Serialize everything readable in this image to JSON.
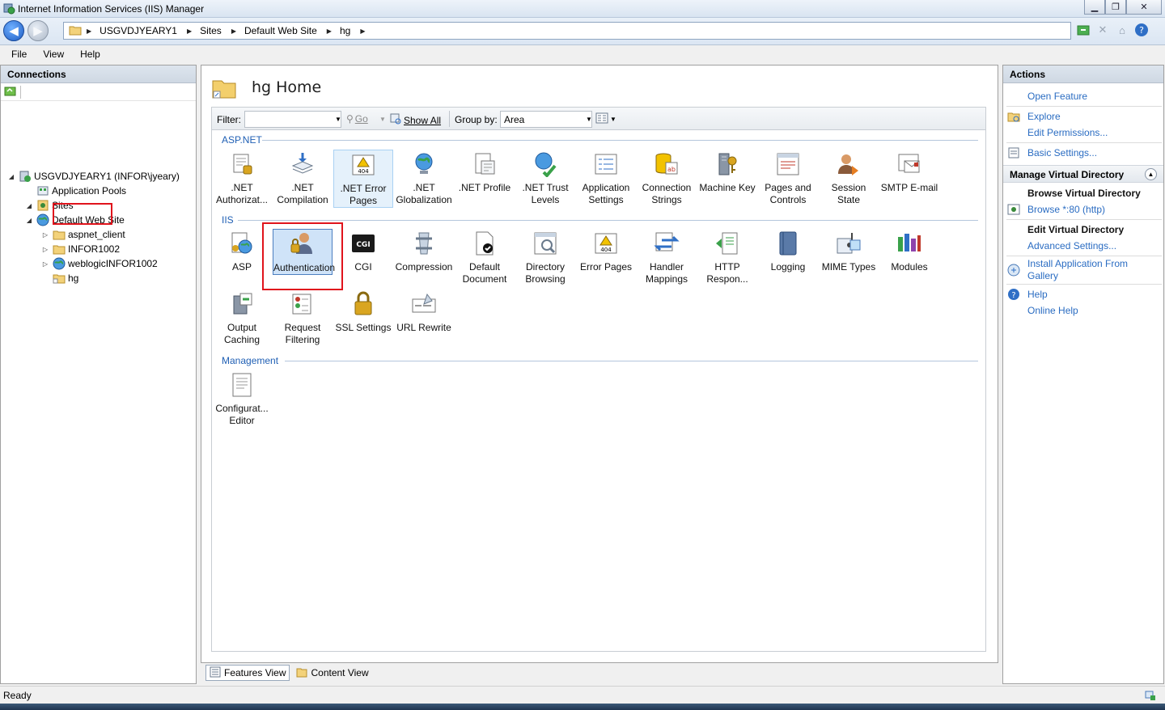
{
  "window": {
    "title": "Internet Information Services (IIS) Manager"
  },
  "address": {
    "crumbs": [
      "USGVDJYEARY1",
      "Sites",
      "Default Web Site",
      "hg"
    ]
  },
  "menu": {
    "file": "File",
    "view": "View",
    "help": "Help"
  },
  "connections": {
    "header": "Connections",
    "tree": [
      {
        "label": "USGVDJYEARY1 (INFOR\\jyeary)",
        "icon": "server-icon",
        "level": 0,
        "expander": "expanded"
      },
      {
        "label": "Application Pools",
        "icon": "app-pools-icon",
        "level": 1,
        "expander": "none"
      },
      {
        "label": "Sites",
        "icon": "sites-icon",
        "level": 1,
        "expander": "expanded"
      },
      {
        "label": "Default Web Site",
        "icon": "globe-icon",
        "level": 2,
        "expander": "expanded"
      },
      {
        "label": "aspnet_client",
        "icon": "folder-icon",
        "level": 3,
        "expander": "collapsed"
      },
      {
        "label": "INFOR1002",
        "icon": "folder-icon",
        "level": 3,
        "expander": "collapsed"
      },
      {
        "label": "weblogicINFOR1002",
        "icon": "globe-icon",
        "level": 3,
        "expander": "collapsed"
      },
      {
        "label": "hg",
        "icon": "virtual-folder-icon",
        "level": 3,
        "expander": "none",
        "selected": true
      }
    ]
  },
  "center": {
    "title": "hg Home",
    "filter": {
      "label": "Filter:",
      "value": "",
      "go": "Go",
      "show_all": "Show All",
      "group_by_label": "Group by:",
      "group_by_value": "Area"
    },
    "sections": {
      "aspnet": "ASP.NET",
      "iis": "IIS",
      "management": "Management"
    },
    "aspnet_features": [
      {
        "label": ".NET Authorizat...",
        "icon": "net-authorization-icon"
      },
      {
        "label": ".NET Compilation",
        "icon": "net-compilation-icon"
      },
      {
        "label": ".NET Error Pages",
        "icon": "net-error-pages-icon"
      },
      {
        "label": ".NET Globalization",
        "icon": "net-globalization-icon"
      },
      {
        "label": ".NET Profile",
        "icon": "net-profile-icon"
      },
      {
        "label": ".NET Trust Levels",
        "icon": "net-trust-levels-icon"
      },
      {
        "label": "Application Settings",
        "icon": "application-settings-icon"
      },
      {
        "label": "Connection Strings",
        "icon": "connection-strings-icon"
      },
      {
        "label": "Machine Key",
        "icon": "machine-key-icon"
      },
      {
        "label": "Pages and Controls",
        "icon": "pages-controls-icon"
      },
      {
        "label": "Session State",
        "icon": "session-state-icon"
      },
      {
        "label": "SMTP E-mail",
        "icon": "smtp-email-icon"
      }
    ],
    "iis_features": [
      {
        "label": "ASP",
        "icon": "asp-icon"
      },
      {
        "label": "Authentication",
        "icon": "authentication-icon"
      },
      {
        "label": "CGI",
        "icon": "cgi-icon"
      },
      {
        "label": "Compression",
        "icon": "compression-icon"
      },
      {
        "label": "Default Document",
        "icon": "default-document-icon"
      },
      {
        "label": "Directory Browsing",
        "icon": "directory-browsing-icon"
      },
      {
        "label": "Error Pages",
        "icon": "error-pages-icon"
      },
      {
        "label": "Handler Mappings",
        "icon": "handler-mappings-icon"
      },
      {
        "label": "HTTP Respon...",
        "icon": "http-response-icon"
      },
      {
        "label": "Logging",
        "icon": "logging-icon"
      },
      {
        "label": "MIME Types",
        "icon": "mime-types-icon"
      },
      {
        "label": "Modules",
        "icon": "modules-icon"
      },
      {
        "label": "Output Caching",
        "icon": "output-caching-icon"
      },
      {
        "label": "Request Filtering",
        "icon": "request-filtering-icon"
      },
      {
        "label": "SSL Settings",
        "icon": "ssl-settings-icon"
      },
      {
        "label": "URL Rewrite",
        "icon": "url-rewrite-icon"
      }
    ],
    "management_features": [
      {
        "label": "Configurat... Editor",
        "icon": "configuration-editor-icon"
      }
    ],
    "tabs": {
      "features_view": "Features View",
      "content_view": "Content View"
    }
  },
  "actions": {
    "header": "Actions",
    "open_feature": "Open Feature",
    "explore": "Explore",
    "edit_permissions": "Edit Permissions...",
    "basic_settings": "Basic Settings...",
    "manage_group": "Manage Virtual Directory",
    "browse_header": "Browse Virtual Directory",
    "browse_80": "Browse *:80 (http)",
    "edit_header": "Edit Virtual Directory",
    "advanced_settings": "Advanced Settings...",
    "install_gallery": "Install Application From Gallery",
    "help": "Help",
    "online_help": "Online Help"
  },
  "status": {
    "text": "Ready"
  },
  "colors": {
    "highlight_box": "#e0141c",
    "link": "#2a6cc2",
    "section": "#1f5fb4"
  }
}
